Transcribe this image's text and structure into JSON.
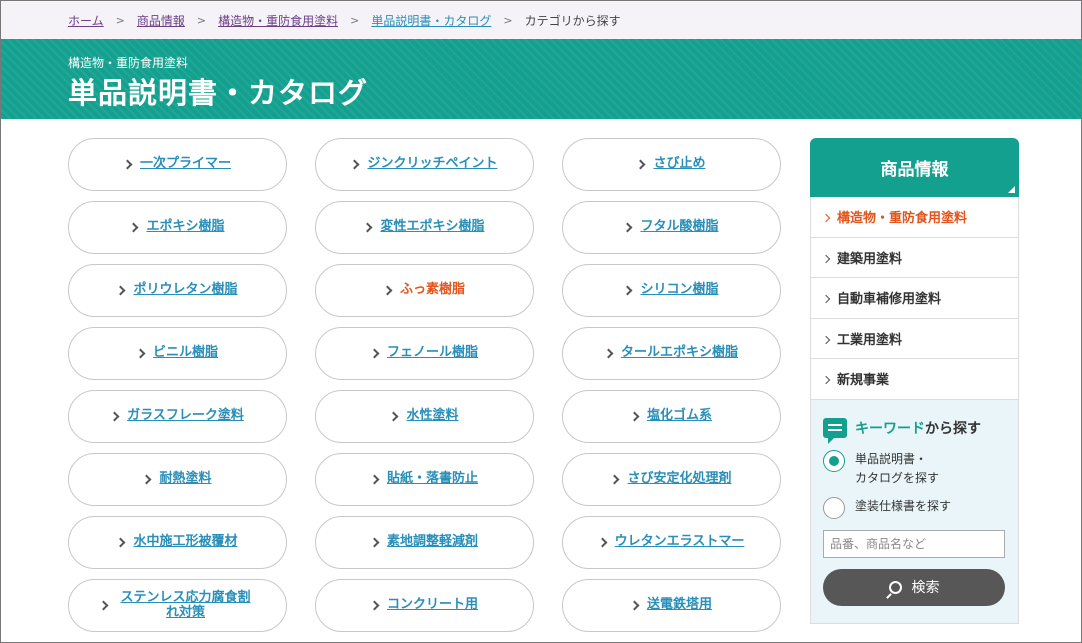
{
  "breadcrumb": {
    "items": [
      "ホーム",
      "商品情報",
      "構造物・重防食用塗料",
      "単品説明書・カタログ"
    ],
    "current": "カテゴリから探す",
    "separator": ">"
  },
  "header": {
    "subtitle": "構造物・重防食用塗料",
    "title": "単品説明書・カタログ"
  },
  "categories": [
    "一次プライマー",
    "ジンクリッチペイント",
    "さび止め",
    "エポキシ樹脂",
    "変性エポキシ樹脂",
    "フタル酸樹脂",
    "ポリウレタン樹脂",
    "ふっ素樹脂",
    "シリコン樹脂",
    "ビニル樹脂",
    "フェノール樹脂",
    "タールエポキシ樹脂",
    "ガラスフレーク塗料",
    "水性塗料",
    "塩化ゴム系",
    "耐熱塗料",
    "貼紙・落書防止",
    "さび安定化処理剤",
    "水中施工形被覆材",
    "素地調整軽減剤",
    "ウレタンエラストマー",
    "ステンレス応力腐食割れ対策",
    "コンクリート用",
    "送電鉄塔用"
  ],
  "active_category": "ふっ素樹脂",
  "sidebar": {
    "title": "商品情報",
    "items": [
      "構造物・重防食用塗料",
      "建築用塗料",
      "自動車補修用塗料",
      "工業用塗料",
      "新規事業"
    ],
    "active_item": "構造物・重防食用塗料"
  },
  "keyword": {
    "title_highlight": "キーワード",
    "title_rest": "から探す",
    "options": [
      {
        "line1": "単品説明書・",
        "line2": "カタログを探す",
        "checked": true
      },
      {
        "line1": "塗装仕様書を探す",
        "line2": "",
        "checked": false
      }
    ],
    "input_placeholder": "品番、商品名など",
    "search_label": "検索"
  },
  "colors": {
    "brand_green": "#14a08f",
    "link_blue": "#2a8fb8",
    "active_orange": "#e3551c",
    "breadcrumb_purple": "#6b3f86"
  }
}
